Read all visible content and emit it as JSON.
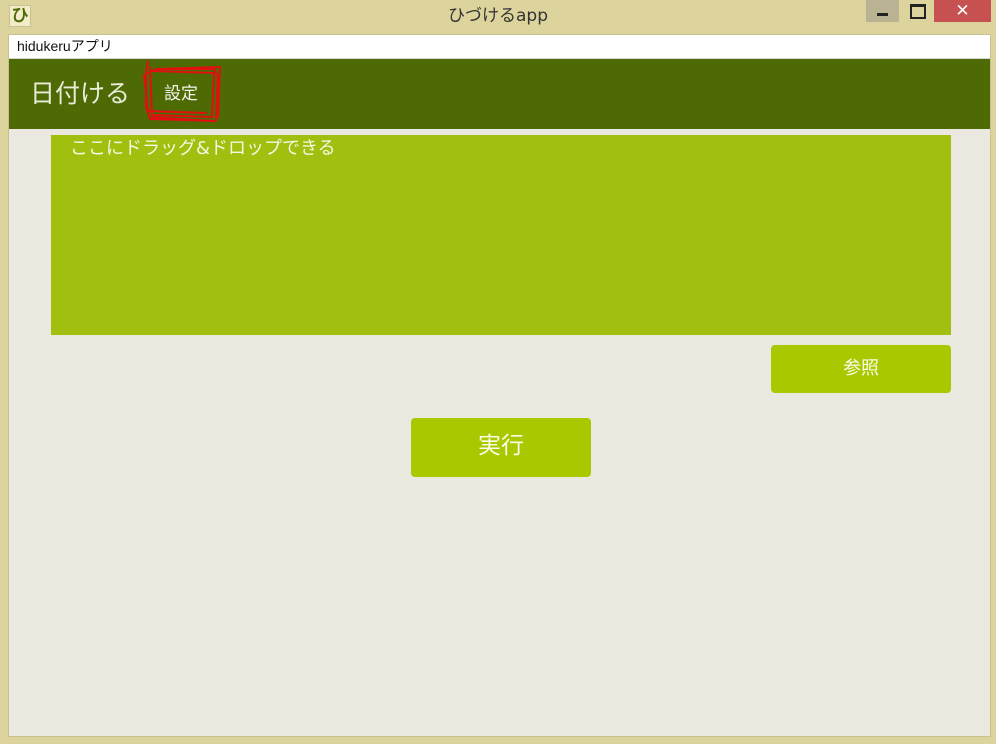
{
  "window": {
    "title": "ひづけるapp",
    "icon_glyph": "ひ",
    "close_glyph": "✕"
  },
  "addressbar": {
    "text": "hidukeruアプリ"
  },
  "header": {
    "brand": "日付ける",
    "settings_label": "設定",
    "annotation_color": "#e01010"
  },
  "main": {
    "dropzone_label": "ここにドラッグ&ドロップできる",
    "browse_label": "参照",
    "run_label": "実行"
  },
  "colors": {
    "header": "#4e6a05",
    "dropzone": "#a0bf0e",
    "button": "#aac800",
    "background": "#eae8df"
  }
}
